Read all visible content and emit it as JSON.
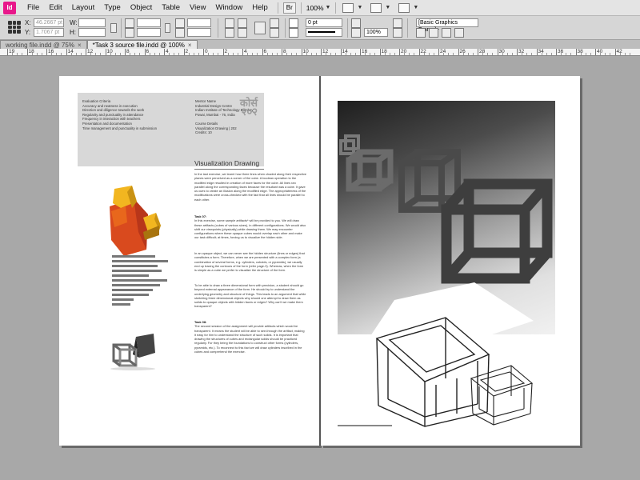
{
  "app": {
    "logo_text": "Id"
  },
  "menubar": {
    "items": [
      "File",
      "Edit",
      "Layout",
      "Type",
      "Object",
      "Table",
      "View",
      "Window",
      "Help"
    ],
    "br_label": "Br",
    "zoom": "100%"
  },
  "control_panel": {
    "x_label": "X:",
    "y_label": "Y:",
    "w_label": "W:",
    "h_label": "H:",
    "x_value": "46.2667 pt",
    "y_value": "1.7067 pt",
    "stroke_weight": "0 pt",
    "scale_value": "100%",
    "frame_style": "[Basic Graphics Frame]+"
  },
  "tabs": [
    {
      "label": "working file.indd @ 75%"
    },
    {
      "label": "*Task 3 source file.indd @ 100%"
    }
  ],
  "ruler": {
    "labels": [
      "19",
      "18",
      "16",
      "14",
      "12",
      "10",
      "8",
      "6",
      "4",
      "2",
      "0",
      "2",
      "4",
      "6",
      "8",
      "10",
      "12",
      "14",
      "16",
      "18",
      "20",
      "22",
      "24",
      "26",
      "28",
      "30",
      "32",
      "34",
      "36",
      "38",
      "40",
      "42"
    ]
  },
  "left_page": {
    "header_col1": "Evaluation Criteria\nAccuracy and neatness in execution\nDirection and diligence towards the work\nRegularity and punctuality in attendance\nFrequency in interaction with teachers\nPresentation and documentation\nTime management and punctuality in submission",
    "header_col2": "Mentor Name\nIndustrial Design Centre\nIndian Institute of Technology Bombay\nPowai, Mumbai - 76, India\n\nCourse Details\nVisualization Drawing | 202\nCredits: 10",
    "logo_line1": "कोर्स",
    "logo_line2": "२०२",
    "title": "Visualization Drawing",
    "para1": "In the last exercise, we learnt how three lines when chaded along their respective planes were perceived as a corner of the cube. A boolean operation to the modified edge resulted in creation of more faces for the cube. All lines ran parallel along the corresponding faces because the resultant was a cube. It gave us cues to create an illusion along the modified edge. The appropriateness of the modifications were cross-checked with the fact that all lines should be parallel to each other.",
    "para2_head": "Task 07:",
    "para2": "In this exercise, some sample artifacts* will be provided to you. We will draw these artifacts (cubes of various sizes), in different configurations. We would also shift our viewpoints (physically) while drawing them. We may encounter configurations where these opaque cubes would overlap each other and make our task difficult; at times, forcing us to visualize the hidden side.",
    "para3": "In an opaque object, we can never see the hidden structure (lines or edges) that constitutes a form. Therefore, when we are presented with a complex form (a combination of several forms, e.g. cylinders, cuboids, or pyramids), we usually end up tracing the contours of the form (refer page-3). Whereas, when the form is simple as a cube we prefer to visualize the structure of the form.",
    "para4": "To be able to draw a three dimensional form with precision, a student should go beyond external appearance of the form. He should try to understand the underlying geometry and structure of things. This leads to an argument that while sketching three dimensional objects why should one attempt to draw them as solids to opaque objects with hidden faces or edges? Why can't we make them transparent?",
    "para5_head": "Task 08:",
    "para5": "The second session of the assignment will provide artifacts which would be transparent. It means the student will be able to see-through the artifact, making it easy for him to understand the structure of such solids. It is important that drawing the structures of cubes and rectangular solids should be practiced regularly. For they being the foundations to construct other forms (cylinders, pyramids, etc.). To reconnect to this fact we will draw cylinders inscribed in the cubes and comprehend the exercise.",
    "bar_fractions": [
      0.77,
      1.0,
      0.81,
      0.88,
      0.65,
      0.98,
      0.85,
      0.73,
      0.65,
      0.38,
      0.33
    ]
  },
  "colors": {
    "brand": "#e8178a",
    "cube_orange": "#d94a1e",
    "cube_yellow": "#f2b620",
    "header_gray": "#d8d8d8",
    "pasteboard": "#a8a8a8"
  }
}
